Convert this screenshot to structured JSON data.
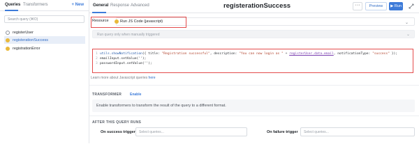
{
  "queries_panel": {
    "tabs": [
      "Queries",
      "Transformers"
    ],
    "new_label": "+ New",
    "search_placeholder": "Search query (⌘O)",
    "items": [
      {
        "label": "registerUser",
        "type": "rest",
        "active": false
      },
      {
        "label": "registerationSuccess",
        "type": "js",
        "active": true
      },
      {
        "label": "registrationError",
        "type": "js",
        "active": false
      }
    ]
  },
  "editor": {
    "tabs": [
      "General",
      "Response",
      "Advanced"
    ],
    "title": "registerationSuccess",
    "more_label": "···",
    "preview_label": "Preview",
    "run_label": "Run",
    "resource_label": "Resource",
    "resource_value": "Run JS Code (javascript)",
    "trigger_placeholder": "Run query only when manually triggered",
    "code": {
      "line_numbers": [
        "1",
        "2",
        "3"
      ],
      "line1": {
        "fn": "utils.showNotification",
        "a": "({ title: ",
        "s1": "\"Registration successful\"",
        "b": ", description: ",
        "s2": "\"You can now login as \"",
        "c": " + ",
        "u": "registerUser.data.email",
        "d": ", notificationType: ",
        "s3": "\"success\"",
        "e": " });"
      },
      "line2": "emailInput.setValue('');",
      "line3": "passwordInput.setValue('');"
    },
    "learn_more_text": "Learn more about Javascript queries",
    "learn_more_link": "here",
    "transformer_label": "TRANSFORMER",
    "enable_label": "Enable",
    "transformer_description": "Enable transformers to transform the result of the query to a different format.",
    "after_run_label": "AFTER THIS QUERY RUNS",
    "on_success_label": "On success trigger",
    "on_failure_label": "On failure trigger",
    "select_placeholder": "Select queries..."
  },
  "colors": {
    "accent": "#3d7bd9",
    "highlight_border": "#e44b4b",
    "js_icon": "#e9b93a"
  }
}
